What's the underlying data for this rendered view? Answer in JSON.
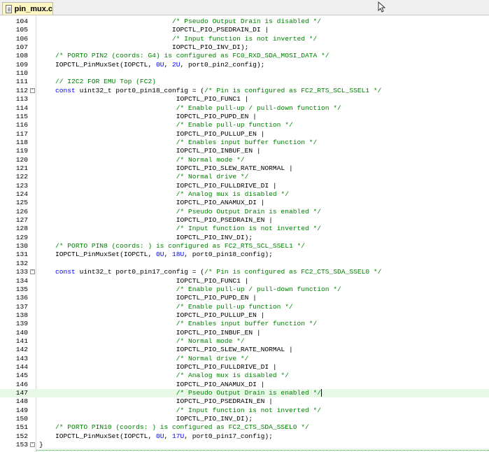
{
  "tab": {
    "label": "pin_mux.c",
    "icon": "file-icon"
  },
  "lines": [
    {
      "n": "104",
      "parts": [
        [
          "",
          "                                 "
        ],
        [
          "c-comment",
          "/* Pseudo Output Drain is disabled */"
        ]
      ]
    },
    {
      "n": "105",
      "parts": [
        [
          "",
          "                                 IOPCTL_PIO_PSEDRAIN_DI |"
        ]
      ]
    },
    {
      "n": "106",
      "parts": [
        [
          "",
          "                                 "
        ],
        [
          "c-comment",
          "/* Input function is not inverted */"
        ]
      ]
    },
    {
      "n": "107",
      "parts": [
        [
          "",
          "                                 IOPCTL_PIO_INV_DI);"
        ]
      ]
    },
    {
      "n": "108",
      "parts": [
        [
          "",
          "    "
        ],
        [
          "c-comment",
          "/* PORTO PIN2 (coords: G4) is configured as FC0_RXD_SDA_MOSI_DATA */"
        ]
      ]
    },
    {
      "n": "109",
      "parts": [
        [
          "",
          "    IOPCTL_PinMuxSet(IOPCTL, "
        ],
        [
          "c-num",
          "0U"
        ],
        [
          "",
          ", "
        ],
        [
          "c-num",
          "2U"
        ],
        [
          "",
          ", port0_pin2_config);"
        ]
      ]
    },
    {
      "n": "110",
      "parts": [
        [
          "",
          ""
        ]
      ]
    },
    {
      "n": "111",
      "parts": [
        [
          "",
          "    "
        ],
        [
          "c-comment",
          "// I2C2 FOR EMU Top (FC2)"
        ]
      ]
    },
    {
      "n": "112",
      "fold": "-",
      "parts": [
        [
          "",
          "    "
        ],
        [
          "c-kw",
          "const"
        ],
        [
          "",
          " uint32_t port0_pin18_config = ("
        ],
        [
          "c-comment",
          "/* Pin is configured as FC2_RTS_SCL_SSEL1 */"
        ]
      ]
    },
    {
      "n": "113",
      "parts": [
        [
          "",
          "                                  IOPCTL_PIO_FUNC1 |"
        ]
      ]
    },
    {
      "n": "114",
      "parts": [
        [
          "",
          "                                  "
        ],
        [
          "c-comment",
          "/* Enable pull-up / pull-down function */"
        ]
      ]
    },
    {
      "n": "115",
      "parts": [
        [
          "",
          "                                  IOPCTL_PIO_PUPD_EN |"
        ]
      ]
    },
    {
      "n": "116",
      "parts": [
        [
          "",
          "                                  "
        ],
        [
          "c-comment",
          "/* Enable pull-up function */"
        ]
      ]
    },
    {
      "n": "117",
      "parts": [
        [
          "",
          "                                  IOPCTL_PIO_PULLUP_EN |"
        ]
      ]
    },
    {
      "n": "118",
      "parts": [
        [
          "",
          "                                  "
        ],
        [
          "c-comment",
          "/* Enables input buffer function */"
        ]
      ]
    },
    {
      "n": "119",
      "parts": [
        [
          "",
          "                                  IOPCTL_PIO_INBUF_EN |"
        ]
      ]
    },
    {
      "n": "120",
      "parts": [
        [
          "",
          "                                  "
        ],
        [
          "c-comment",
          "/* Normal mode */"
        ]
      ]
    },
    {
      "n": "121",
      "parts": [
        [
          "",
          "                                  IOPCTL_PIO_SLEW_RATE_NORMAL |"
        ]
      ]
    },
    {
      "n": "122",
      "parts": [
        [
          "",
          "                                  "
        ],
        [
          "c-comment",
          "/* Normal drive */"
        ]
      ]
    },
    {
      "n": "123",
      "parts": [
        [
          "",
          "                                  IOPCTL_PIO_FULLDRIVE_DI |"
        ]
      ]
    },
    {
      "n": "124",
      "parts": [
        [
          "",
          "                                  "
        ],
        [
          "c-comment",
          "/* Analog mux is disabled */"
        ]
      ]
    },
    {
      "n": "125",
      "parts": [
        [
          "",
          "                                  IOPCTL_PIO_ANAMUX_DI |"
        ]
      ]
    },
    {
      "n": "126",
      "parts": [
        [
          "",
          "                                  "
        ],
        [
          "c-comment",
          "/* Pseudo Output Drain is enabled */"
        ]
      ]
    },
    {
      "n": "127",
      "parts": [
        [
          "",
          "                                  IOPCTL_PIO_PSEDRAIN_EN |"
        ]
      ]
    },
    {
      "n": "128",
      "parts": [
        [
          "",
          "                                  "
        ],
        [
          "c-comment",
          "/* Input function is not inverted */"
        ]
      ]
    },
    {
      "n": "129",
      "parts": [
        [
          "",
          "                                  IOPCTL_PIO_INV_DI);"
        ]
      ]
    },
    {
      "n": "130",
      "parts": [
        [
          "",
          "    "
        ],
        [
          "c-comment",
          "/* PORTO PIN8 (coords: ) is configured as FC2_RTS_SCL_SSEL1 */"
        ]
      ]
    },
    {
      "n": "131",
      "parts": [
        [
          "",
          "    IOPCTL_PinMuxSet(IOPCTL, "
        ],
        [
          "c-num",
          "0U"
        ],
        [
          "",
          ", "
        ],
        [
          "c-num",
          "18U"
        ],
        [
          "",
          ", port0_pin18_config);"
        ]
      ]
    },
    {
      "n": "132",
      "parts": [
        [
          "",
          ""
        ]
      ]
    },
    {
      "n": "133",
      "fold": "-",
      "parts": [
        [
          "",
          "    "
        ],
        [
          "c-kw",
          "const"
        ],
        [
          "",
          " uint32_t port0_pin17_config = ("
        ],
        [
          "c-comment",
          "/* Pin is configured as FC2_CTS_SDA_SSEL0 */"
        ]
      ]
    },
    {
      "n": "134",
      "parts": [
        [
          "",
          "                                  IOPCTL_PIO_FUNC1 |"
        ]
      ]
    },
    {
      "n": "135",
      "parts": [
        [
          "",
          "                                  "
        ],
        [
          "c-comment",
          "/* Enable pull-up / pull-down function */"
        ]
      ]
    },
    {
      "n": "136",
      "parts": [
        [
          "",
          "                                  IOPCTL_PIO_PUPD_EN |"
        ]
      ]
    },
    {
      "n": "137",
      "parts": [
        [
          "",
          "                                  "
        ],
        [
          "c-comment",
          "/* Enable pull-up function */"
        ]
      ]
    },
    {
      "n": "138",
      "parts": [
        [
          "",
          "                                  IOPCTL_PIO_PULLUP_EN |"
        ]
      ]
    },
    {
      "n": "139",
      "parts": [
        [
          "",
          "                                  "
        ],
        [
          "c-comment",
          "/* Enables input buffer function */"
        ]
      ]
    },
    {
      "n": "140",
      "parts": [
        [
          "",
          "                                  IOPCTL_PIO_INBUF_EN |"
        ]
      ]
    },
    {
      "n": "141",
      "parts": [
        [
          "",
          "                                  "
        ],
        [
          "c-comment",
          "/* Normal mode */"
        ]
      ]
    },
    {
      "n": "142",
      "parts": [
        [
          "",
          "                                  IOPCTL_PIO_SLEW_RATE_NORMAL |"
        ]
      ]
    },
    {
      "n": "143",
      "parts": [
        [
          "",
          "                                  "
        ],
        [
          "c-comment",
          "/* Normal drive */"
        ]
      ]
    },
    {
      "n": "144",
      "parts": [
        [
          "",
          "                                  IOPCTL_PIO_FULLDRIVE_DI |"
        ]
      ]
    },
    {
      "n": "145",
      "parts": [
        [
          "",
          "                                  "
        ],
        [
          "c-comment",
          "/* Analog mux is disabled */"
        ]
      ]
    },
    {
      "n": "146",
      "parts": [
        [
          "",
          "                                  IOPCTL_PIO_ANAMUX_DI |"
        ]
      ]
    },
    {
      "n": "147",
      "hl": true,
      "cursor": true,
      "parts": [
        [
          "",
          "                                  "
        ],
        [
          "c-comment",
          "/* Pseudo Output Drain is enabled */"
        ]
      ]
    },
    {
      "n": "148",
      "parts": [
        [
          "",
          "                                  IOPCTL_PIO_PSEDRAIN_EN |"
        ]
      ]
    },
    {
      "n": "149",
      "parts": [
        [
          "",
          "                                  "
        ],
        [
          "c-comment",
          "/* Input function is not inverted */"
        ]
      ]
    },
    {
      "n": "150",
      "parts": [
        [
          "",
          "                                  IOPCTL_PIO_INV_DI);"
        ]
      ]
    },
    {
      "n": "151",
      "parts": [
        [
          "",
          "    "
        ],
        [
          "c-comment",
          "/* PORTO PIN10 (coords: ) is configured as FC2_CTS_SDA_SSEL0 */"
        ]
      ]
    },
    {
      "n": "152",
      "parts": [
        [
          "",
          "    IOPCTL_PinMuxSet(IOPCTL, "
        ],
        [
          "c-num",
          "0U"
        ],
        [
          "",
          ", "
        ],
        [
          "c-num",
          "17U"
        ],
        [
          "",
          ", port0_pin17_config);"
        ]
      ]
    },
    {
      "n": "153",
      "fold": "-",
      "parts": [
        [
          "",
          "}"
        ]
      ]
    }
  ],
  "colors": {
    "comment": "#008000",
    "keyword": "#0000ff",
    "highlight": "#e7f8e7",
    "tab": "#fff7c2"
  }
}
